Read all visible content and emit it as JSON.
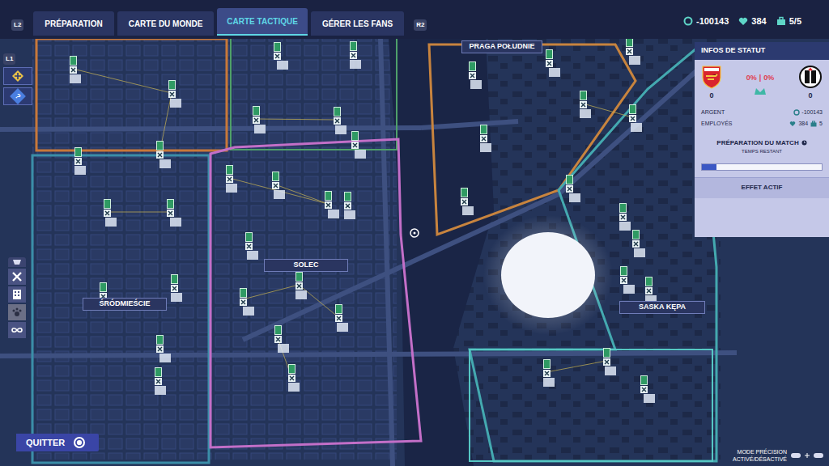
{
  "top_bar": {
    "left_key": "L2",
    "tabs": [
      {
        "label": "PRÉPARATION",
        "selected": false
      },
      {
        "label": "CARTE DU MONDE",
        "selected": false
      },
      {
        "label": "CARTE TACTIQUE",
        "selected": true
      },
      {
        "label": "GÉRER LES FANS",
        "selected": false
      }
    ],
    "right_key": "R2",
    "resources": [
      {
        "value": "-100143",
        "kind": "money"
      },
      {
        "value": "384",
        "kind": "fans"
      },
      {
        "value": "5/5",
        "kind": "staff"
      }
    ]
  },
  "left_panel": {
    "key": "L1",
    "help_glyph": "?"
  },
  "map": {
    "districts": [
      {
        "label": "PRAGA POŁUDNIE"
      },
      {
        "label": "SOLEC"
      },
      {
        "label": "ŚRÓDMIEŚCIE"
      },
      {
        "label": "SASKA KĘPA"
      }
    ]
  },
  "status_panel": {
    "title": "INFOS DE STATUT",
    "home_pct": "0%",
    "separator": "|",
    "away_pct": "0%",
    "home_score": "0",
    "away_score": "0",
    "money": {
      "label": "ARGENT",
      "value": "-100143"
    },
    "employees": {
      "label": "EMPLOYÉS",
      "fans": "384",
      "staff": "5"
    },
    "match_prep": {
      "title": "PRÉPARATION DU MATCH",
      "subtitle": "TEMPS RESTANT",
      "level": 0.12
    },
    "active_effect": {
      "title": "EFFET ACTIF"
    }
  },
  "quit_button": {
    "label": "QUITTER"
  },
  "precision_mode": {
    "line1": "MODE PRÉCISION",
    "line2": "ACTIVÉ/DÉSACTIVÉ"
  }
}
